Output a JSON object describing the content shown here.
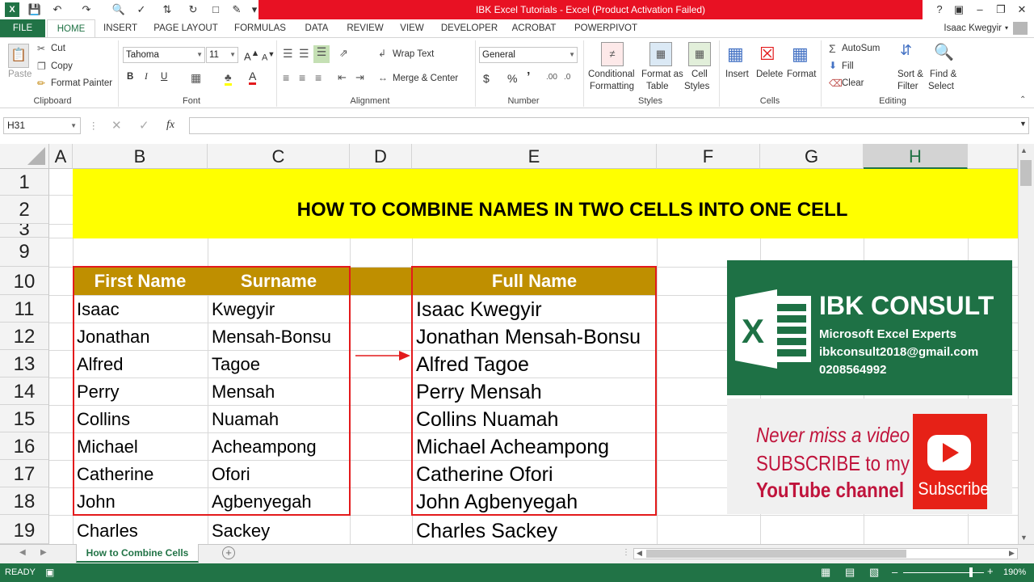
{
  "window": {
    "title": "IBK Excel Tutorials -  Excel (Product Activation Failed)",
    "help": "?"
  },
  "colors": {
    "excel_green": "#217346",
    "title_red": "#e81123",
    "header_gold": "#bf8f00",
    "banner_yellow": "#ffff00",
    "box_red": "#e31a1c"
  },
  "ribbon_tabs": [
    "FILE",
    "HOME",
    "INSERT",
    "PAGE LAYOUT",
    "FORMULAS",
    "DATA",
    "REVIEW",
    "VIEW",
    "DEVELOPER",
    "ACROBAT",
    "POWERPIVOT"
  ],
  "user": "Isaac Kwegyir",
  "clipboard": {
    "paste": "Paste",
    "cut": "Cut",
    "copy": "Copy",
    "format_painter": "Format Painter",
    "label": "Clipboard"
  },
  "font": {
    "name": "Tahoma",
    "size": "11",
    "bold": "B",
    "italic": "I",
    "underline": "U",
    "label": "Font"
  },
  "alignment": {
    "wrap": "Wrap Text",
    "merge": "Merge & Center",
    "label": "Alignment"
  },
  "number": {
    "format": "General",
    "currency": "$",
    "percent": "%",
    "comma": "’",
    "label": "Number"
  },
  "styles": {
    "conditional": "Conditional",
    "conditional2": "Formatting",
    "format_as": "Format as",
    "format_as2": "Table",
    "cell": "Cell",
    "cell2": "Styles",
    "label": "Styles"
  },
  "cells": {
    "insert": "Insert",
    "delete": "Delete",
    "format": "Format",
    "label": "Cells"
  },
  "editing": {
    "autosum": "AutoSum",
    "fill": "Fill",
    "clear": "Clear",
    "sort": "Sort &",
    "sort2": "Filter",
    "find": "Find &",
    "find2": "Select",
    "label": "Editing"
  },
  "formula_bar": {
    "name_box": "H31",
    "fx": "fx",
    "value": ""
  },
  "columns": [
    "A",
    "B",
    "C",
    "D",
    "E",
    "F",
    "G",
    "H"
  ],
  "rows": [
    "1",
    "2",
    "3",
    "9",
    "10",
    "11",
    "12",
    "13",
    "14",
    "15",
    "16",
    "17",
    "18",
    "19"
  ],
  "sheet": {
    "title": "HOW TO COMBINE NAMES IN TWO CELLS INTO ONE CELL",
    "headers": {
      "first": "First Name",
      "surname": "Surname",
      "full": "Full Name"
    },
    "people": [
      {
        "first": "Isaac",
        "surname": "Kwegyir",
        "full": "Isaac Kwegyir"
      },
      {
        "first": "Jonathan",
        "surname": "Mensah-Bonsu",
        "full": "Jonathan Mensah-Bonsu"
      },
      {
        "first": "Alfred",
        "surname": "Tagoe",
        "full": "Alfred Tagoe"
      },
      {
        "first": "Perry",
        "surname": "Mensah",
        "full": "Perry Mensah"
      },
      {
        "first": "Collins",
        "surname": "Nuamah",
        "full": "Collins Nuamah"
      },
      {
        "first": "Michael",
        "surname": "Acheampong",
        "full": "Michael Acheampong"
      },
      {
        "first": "Catherine",
        "surname": "Ofori",
        "full": "Catherine Ofori"
      },
      {
        "first": "John",
        "surname": "Agbenyegah",
        "full": "John Agbenyegah"
      },
      {
        "first": "Charles",
        "surname": "Sackey",
        "full": "Charles Sackey"
      }
    ]
  },
  "ibk": {
    "name": "IBK CONSULT",
    "tagline": "Microsoft Excel Experts",
    "email": "ibkconsult2018@gmail.com",
    "phone": "0208564992"
  },
  "youtube": {
    "line1": "Never miss a video",
    "line2": "SUBSCRIBE to my",
    "line3": "YouTube channel",
    "button": "Subscribe"
  },
  "sheet_tab": "How to Combine Cells",
  "status": {
    "ready": "READY",
    "zoom": "190%"
  }
}
